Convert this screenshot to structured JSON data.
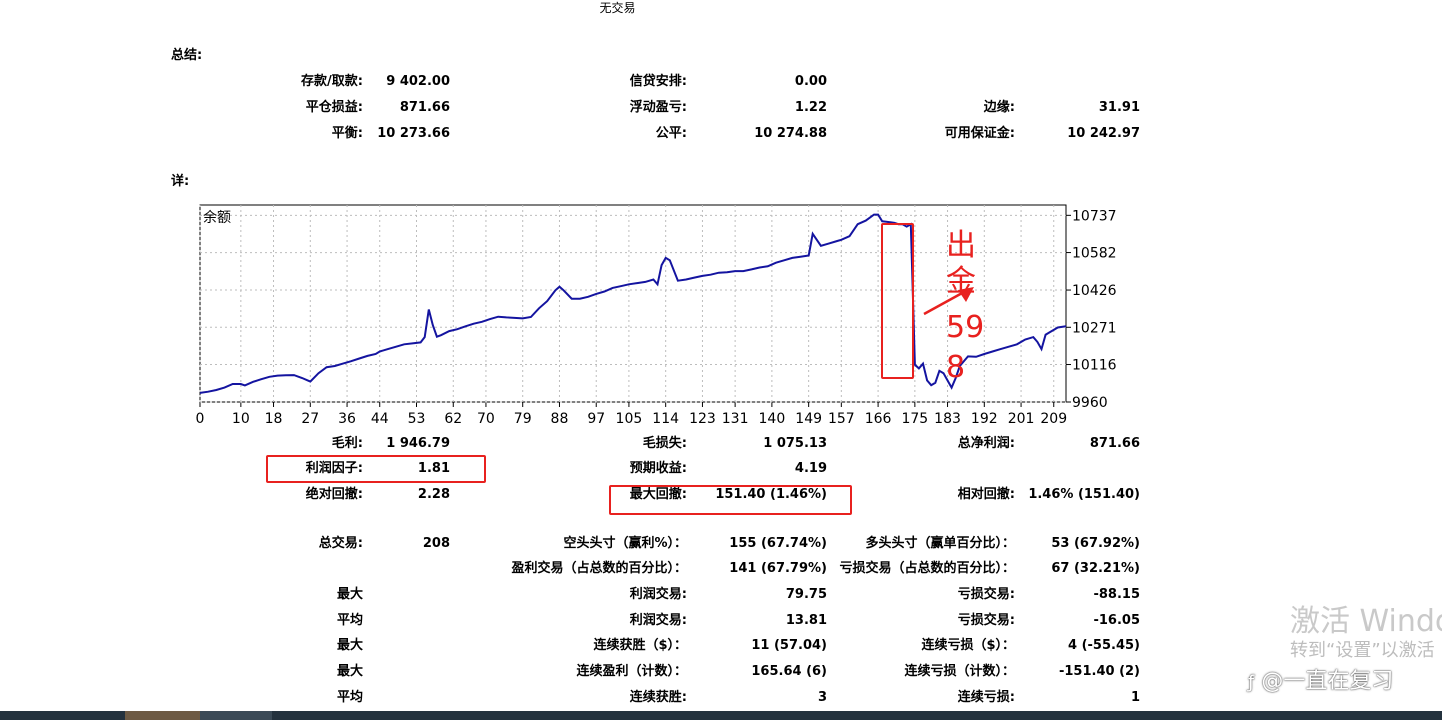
{
  "report_title": "无交易",
  "summary": {
    "heading": "总结:",
    "rows": [
      [
        {
          "label": "存款/取款:",
          "value": "9 402.00"
        },
        {
          "label": "信贷安排:",
          "value": "0.00"
        },
        null
      ],
      [
        {
          "label": "平仓损益:",
          "value": "871.66"
        },
        {
          "label": "浮动盈亏:",
          "value": "1.22"
        },
        {
          "label": "边缘:",
          "value": "31.91"
        }
      ],
      [
        {
          "label": "平衡:",
          "value": "10 273.66"
        },
        {
          "label": "公平:",
          "value": "10 274.88"
        },
        {
          "label": "可用保证金:",
          "value": "10 242.97"
        }
      ]
    ]
  },
  "details": {
    "heading": "详:",
    "rows": [
      [
        {
          "label": "毛利:",
          "value": "1 946.79"
        },
        {
          "label": "毛损失:",
          "value": "1 075.13"
        },
        {
          "label": "总净利润:",
          "value": "871.66"
        }
      ],
      [
        {
          "label": "利润因子:",
          "value": "1.81"
        },
        {
          "label": "预期收益:",
          "value": "4.19"
        },
        null
      ],
      [
        {
          "label": "绝对回撤:",
          "value": "2.28"
        },
        {
          "label": "最大回撤:",
          "value": "151.40 (1.46%)"
        },
        {
          "label": "相对回撤:",
          "value": "1.46% (151.40)"
        }
      ],
      [
        {
          "label": "总交易:",
          "value": "208"
        },
        {
          "label": "空头头寸（赢利%）：",
          "value": "155 (67.74%)"
        },
        {
          "label": "多头头寸（赢单百分比）：",
          "value": "53 (67.92%)"
        }
      ],
      [
        null,
        {
          "label": "盈利交易（占总数的百分比）：",
          "value": "141 (67.79%)"
        },
        {
          "label": "亏损交易（占总数的百分比）：",
          "value": "67 (32.21%)"
        }
      ],
      [
        {
          "label": "最大",
          "value": ""
        },
        {
          "label": "利润交易:",
          "value": "79.75"
        },
        {
          "label": "亏损交易:",
          "value": "-88.15"
        }
      ],
      [
        {
          "label": "平均",
          "value": ""
        },
        {
          "label": "利润交易:",
          "value": "13.81"
        },
        {
          "label": "亏损交易:",
          "value": "-16.05"
        }
      ],
      [
        {
          "label": "最大",
          "value": ""
        },
        {
          "label": "连续获胜（$）：",
          "value": "11 (57.04)"
        },
        {
          "label": "连续亏损（$）：",
          "value": "4 (-55.45)"
        }
      ],
      [
        {
          "label": "最大",
          "value": ""
        },
        {
          "label": "连续盈利（计数）：",
          "value": "165.64 (6)"
        },
        {
          "label": "连续亏损（计数）：",
          "value": "-151.40 (2)"
        }
      ],
      [
        {
          "label": "平均",
          "value": ""
        },
        {
          "label": "连续获胜:",
          "value": "3"
        },
        {
          "label": "连续亏损:",
          "value": "1"
        }
      ]
    ]
  },
  "chart_data": {
    "type": "line",
    "title": "余额",
    "x_ticks": [
      0,
      10,
      18,
      27,
      36,
      44,
      53,
      62,
      70,
      79,
      88,
      97,
      105,
      114,
      123,
      131,
      140,
      149,
      157,
      166,
      175,
      183,
      192,
      201,
      209
    ],
    "y_ticks": [
      10737,
      10582,
      10426,
      10271,
      10116,
      9960
    ],
    "xlim": [
      0,
      212
    ],
    "ylim": [
      9960,
      10780
    ],
    "grid": true,
    "line_color": "#1414a0",
    "series": [
      {
        "x": [
          0,
          2,
          4,
          6,
          8,
          10,
          11,
          13,
          15,
          17,
          19,
          21,
          23,
          25,
          27,
          29,
          31,
          33,
          35,
          37,
          39,
          41,
          43,
          44,
          46,
          48,
          50,
          52,
          54,
          55,
          56,
          57,
          58,
          59,
          61,
          63,
          65,
          67,
          69,
          71,
          73,
          75,
          77,
          79,
          81,
          83,
          85,
          87,
          88,
          89,
          91,
          93,
          95,
          97,
          99,
          101,
          103,
          105,
          107,
          109,
          111,
          112,
          113,
          114,
          115,
          117,
          119,
          121,
          123,
          125,
          127,
          129,
          131,
          133,
          135,
          137,
          139,
          141,
          143,
          145,
          147,
          149,
          150,
          152,
          154,
          156,
          157,
          159,
          161,
          163,
          165,
          166,
          167,
          168,
          169,
          170,
          171,
          172,
          173,
          174,
          175,
          176,
          177,
          178,
          179,
          180,
          181,
          182,
          183,
          184,
          185,
          186,
          188,
          190,
          192,
          194,
          196,
          198,
          200,
          202,
          204,
          205,
          206,
          207,
          208,
          210,
          212
        ],
        "y": [
          9998,
          10003,
          10010,
          10020,
          10035,
          10035,
          10029,
          10044,
          10055,
          10065,
          10070,
          10071,
          10072,
          10060,
          10045,
          10080,
          10105,
          10110,
          10120,
          10130,
          10141,
          10152,
          10160,
          10170,
          10180,
          10190,
          10200,
          10204,
          10208,
          10230,
          10345,
          10280,
          10232,
          10238,
          10255,
          10263,
          10275,
          10286,
          10294,
          10305,
          10315,
          10312,
          10310,
          10308,
          10314,
          10350,
          10380,
          10425,
          10440,
          10425,
          10390,
          10390,
          10398,
          10410,
          10420,
          10435,
          10442,
          10450,
          10455,
          10460,
          10470,
          10450,
          10530,
          10560,
          10550,
          10465,
          10470,
          10478,
          10485,
          10490,
          10498,
          10500,
          10505,
          10505,
          10512,
          10520,
          10525,
          10540,
          10550,
          10560,
          10565,
          10570,
          10660,
          10610,
          10620,
          10630,
          10635,
          10650,
          10700,
          10715,
          10740,
          10740,
          10712,
          10710,
          10708,
          10706,
          10700,
          10700,
          10690,
          10700,
          10115,
          10100,
          10120,
          10050,
          10030,
          10040,
          10090,
          10080,
          10050,
          10020,
          10060,
          10110,
          10150,
          10148,
          10160,
          10170,
          10180,
          10190,
          10200,
          10220,
          10230,
          10210,
          10180,
          10240,
          10250,
          10270,
          10275
        ]
      }
    ]
  },
  "annotation": {
    "text_line1": "出",
    "text_line2": "金",
    "text_line3": "59",
    "text_line4": "8"
  },
  "watermark": {
    "activate_line1": "激活 Windo",
    "activate_line2": "转到“设置”以激活",
    "credit": "@一直在复习"
  }
}
